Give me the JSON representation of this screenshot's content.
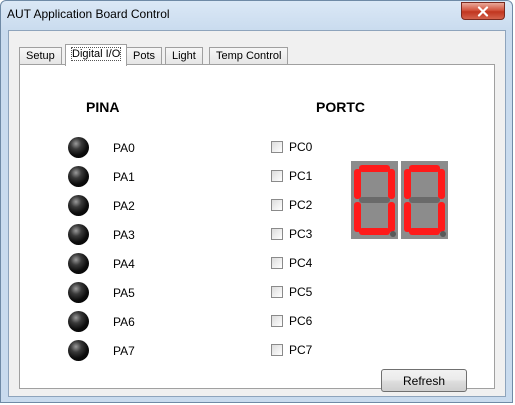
{
  "window": {
    "title": "AUT Application Board Control",
    "close_glyph": "X"
  },
  "tabs": [
    {
      "label": "Setup",
      "active": false
    },
    {
      "label": "Digital I/O",
      "active": true
    },
    {
      "label": "Pots",
      "active": false
    },
    {
      "label": "Light",
      "active": false
    },
    {
      "label": "Temp Control",
      "active": false
    }
  ],
  "pina": {
    "heading": "PINA",
    "pins": [
      {
        "label": "PA0",
        "state": "off"
      },
      {
        "label": "PA1",
        "state": "off"
      },
      {
        "label": "PA2",
        "state": "off"
      },
      {
        "label": "PA3",
        "state": "off"
      },
      {
        "label": "PA4",
        "state": "off"
      },
      {
        "label": "PA5",
        "state": "off"
      },
      {
        "label": "PA6",
        "state": "off"
      },
      {
        "label": "PA7",
        "state": "off"
      }
    ]
  },
  "portc": {
    "heading": "PORTC",
    "pins": [
      {
        "label": "PC0",
        "checked": false
      },
      {
        "label": "PC1",
        "checked": false
      },
      {
        "label": "PC2",
        "checked": false
      },
      {
        "label": "PC3",
        "checked": false
      },
      {
        "label": "PC4",
        "checked": false
      },
      {
        "label": "PC5",
        "checked": false
      },
      {
        "label": "PC6",
        "checked": false
      },
      {
        "label": "PC7",
        "checked": false
      }
    ]
  },
  "display": {
    "value": "00",
    "on_color": "#ff1a1a",
    "off_color": "#6a6a6a"
  },
  "refresh": {
    "label": "Refresh"
  }
}
